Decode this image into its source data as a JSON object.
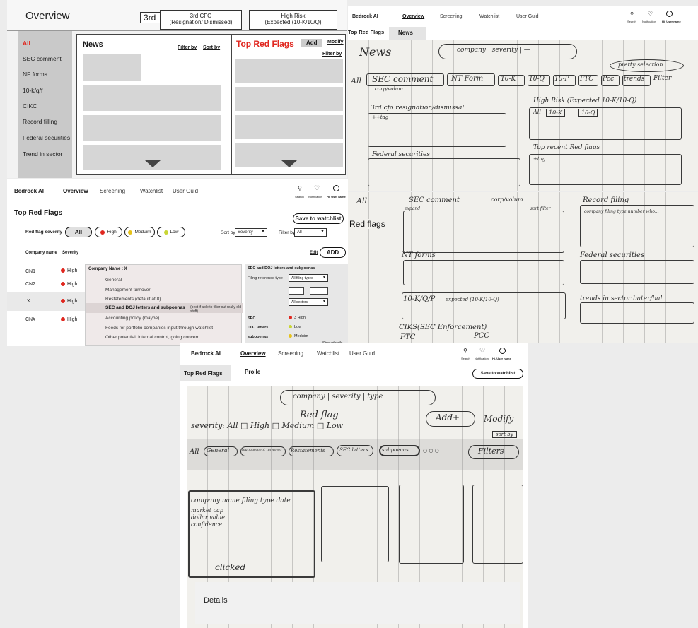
{
  "colors": {
    "red": "#e0271f",
    "grey_box": "#d6d6d6",
    "side_grey": "#c9c9c9",
    "yellow": "#e6c21a",
    "green": "#c9d634"
  },
  "wire_top": {
    "title": "Overview",
    "partial_tab": "3rd",
    "tab_cfo": "3rd CFO\n(Resignation/ Dismissed)",
    "tab_risk": "High Risk\n(Expected (10-K/10/Q)",
    "sidebar": [
      "All",
      "SEC comment",
      "NF forms",
      "10-k/q/f",
      "CIKC",
      "Record filling",
      "Federal securities",
      "Trend in sector"
    ],
    "news_title": "News",
    "filter_by": "Filter by",
    "sort_by": "Sort by",
    "flags_title": "Top Red Flags",
    "add": "Add",
    "modify": "Modify",
    "filter_by2": "Filter by"
  },
  "sketch_top_right": {
    "brand": "Bedrock AI",
    "nav": [
      "Overview",
      "Screening",
      "Watchlist",
      "User Guid"
    ],
    "icons": [
      "Search",
      "Notification",
      "Hi, User name"
    ],
    "tabs": [
      "Top Red Flags",
      "News"
    ],
    "hw": {
      "news": "News",
      "search": "company | severity | —",
      "pretty": "pretty selection",
      "all": "All",
      "tabs": [
        "SEC comment",
        "NT Form",
        "10-K",
        "10-Q",
        "10-P",
        "FTC",
        "Pcc",
        "trends"
      ],
      "filter": "Filter",
      "corp": "corp/volum",
      "cfo": "3rd cfo resignation/dismissal",
      "tag": "++tag",
      "risk": "High Risk (Expected 10-K/10-Q)",
      "risk_tabs": [
        "All",
        "10-K",
        "10-Q"
      ],
      "federal": "Federal securities",
      "top_flags": "Top recent Red flags",
      "tag2": "+tag"
    }
  },
  "sketch_mid_right": {
    "label": "Red flags",
    "hw": {
      "all": "All",
      "sec": "SEC comment",
      "corp": "corp/volum",
      "record": "Record filing",
      "record_sub": "company filing type number who...",
      "nt": "NT forms",
      "federal": "Federal securities",
      "tenk": "10-K/Q/P",
      "expected": "expected (10-K/10-Q)",
      "trends": "trends in sector bater/bal",
      "ciks": "CIKS(SEC Enforcement)",
      "ftc": "FTC",
      "pcc": "PCC",
      "sort": "sort filter",
      "expand": "expand"
    }
  },
  "wire_mid": {
    "brand": "Bedrock AI",
    "nav": [
      "Overview",
      "Screening",
      "Watchlist",
      "User Guid"
    ],
    "icons": [
      "Search",
      "Notification",
      "Hi, User name"
    ],
    "title": "Top Red Flags",
    "save": "Save to watchlist",
    "severity_label": "Red flag severity",
    "sev_buttons": [
      "All",
      "High",
      "Meduim",
      "Low"
    ],
    "sort_by": "Sort by",
    "sort_value": "Severity",
    "filter_by": "Filter by",
    "filter_value": "All",
    "col_company": "Company name",
    "col_severity": "Severity",
    "edit": "Edit",
    "add": "ADD",
    "rows": [
      {
        "name": "CN1",
        "sev": "High"
      },
      {
        "name": "CN2",
        "sev": "High"
      },
      {
        "name": "X",
        "sev": "High"
      },
      {
        "name": "CN#",
        "sev": "High"
      }
    ],
    "panel_title": "Company Name : X",
    "panel_items": [
      "General",
      "Management turnover",
      "Restatements (default at 8)",
      "SEC and DOJ letters and subpoenas",
      "(best if able to filter out really old stuff)",
      "Accounting policy (maybe)",
      "Feeds for portfolio companies input through watchlist",
      "Other potential: internal control, going concern"
    ],
    "right_title": "SEC and DOJ letters and subpoenas",
    "filing_ref": "Filing reference type",
    "filing_value": "All filing types",
    "sector_value": "All sectors",
    "stats": [
      {
        "k": "SEC",
        "v": "3 High"
      },
      {
        "k": "DOJ letters",
        "v": "Low"
      },
      {
        "k": "subpoenas",
        "v": "Meduim"
      }
    ],
    "show_details": "Show details"
  },
  "wire_bottom": {
    "brand": "Bedrock AI",
    "nav": [
      "Overview",
      "Screening",
      "Watchlist",
      "User Guid"
    ],
    "icons": [
      "Search",
      "Notification",
      "Hi, User name"
    ],
    "tabs": [
      "Top Red Flags",
      "Proile"
    ],
    "save": "Save to watchlist",
    "hw": {
      "search": "company | severity | type",
      "redflag": "Red flag",
      "add": "Add+",
      "modify": "Modify",
      "severity": "severity: All  □ High  □ Medium  □ Low",
      "sortby": "sort by",
      "all": "All",
      "pills": [
        "General",
        "management turnover",
        "Restatements",
        "SEC letters",
        "subpoenas"
      ],
      "dots": "○ ○ ○",
      "filters": "Filters",
      "card": "company name    filing type date",
      "card2": "market cap",
      "card3": "dollar value",
      "card4": "confidence",
      "clicked": "clicked"
    },
    "details": "Details"
  }
}
